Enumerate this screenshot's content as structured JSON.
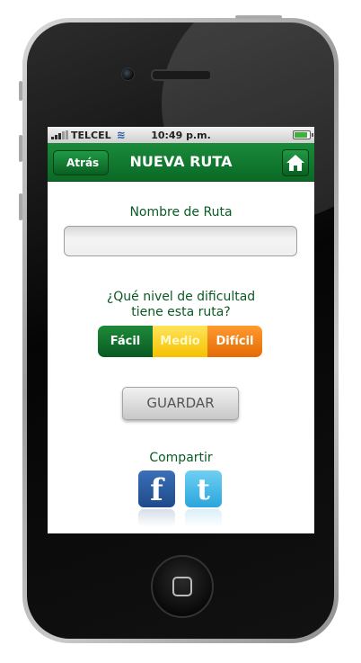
{
  "status": {
    "carrier": "TELCEL",
    "time": "10:49 p.m.",
    "battery_level": 0.8
  },
  "navbar": {
    "back_label": "Atrás",
    "title": "NUEVA RUTA",
    "home_icon": "home-icon"
  },
  "form": {
    "name_label": "Nombre de Ruta",
    "name_value": "",
    "difficulty_question_line1": "¿Qué nivel de dificultad",
    "difficulty_question_line2": "tiene esta ruta?",
    "difficulty_options": [
      "Fácil",
      "Medio",
      "Difícil"
    ],
    "save_label": "GUARDAR"
  },
  "share": {
    "label": "Compartir",
    "facebook": "f",
    "twitter": "t"
  },
  "colors": {
    "accent_green": "#0a6a26",
    "medio_yellow": "#f5c200",
    "dificil_orange": "#e46b06"
  }
}
